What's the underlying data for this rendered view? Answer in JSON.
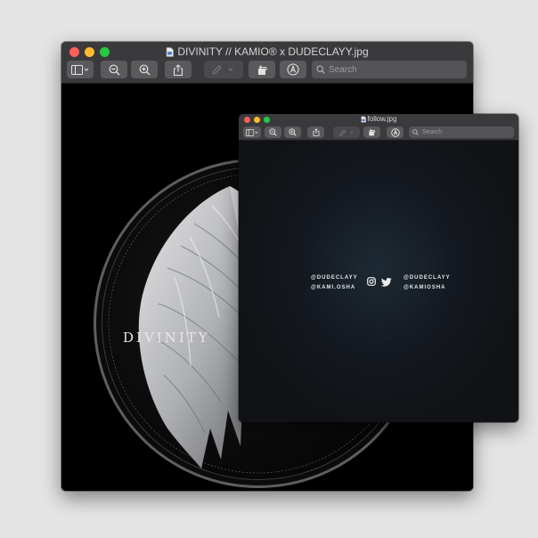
{
  "main_window": {
    "title": "DIVINITY // KAMIO® x DUDECLAYY.jpg",
    "search_placeholder": "Search",
    "artwork": {
      "title": "DIVINITY"
    }
  },
  "follow_window": {
    "title": "follow.jpg",
    "search_placeholder": "Search",
    "handles_left": [
      "@DUDECLAYY",
      "@KAMI.OSHA"
    ],
    "handles_right": [
      "@DUDECLAYY",
      "@KAMIOSHA"
    ]
  }
}
